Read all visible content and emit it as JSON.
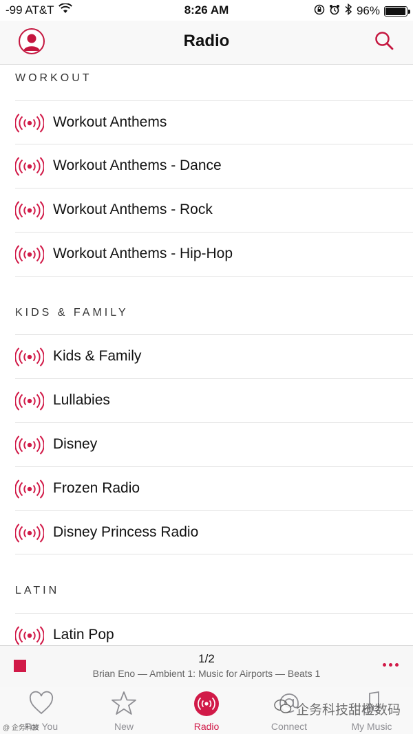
{
  "status_bar": {
    "carrier": "-99 AT&T",
    "time": "8:26 AM",
    "battery_percent": "96%",
    "battery_level": 0.96,
    "icons": [
      "wifi-icon",
      "orientation-lock-icon",
      "alarm-icon",
      "bluetooth-icon",
      "battery-icon"
    ]
  },
  "nav": {
    "title": "Radio",
    "left_icon": "profile-icon",
    "right_icon": "search-icon"
  },
  "sections": [
    {
      "header": "WORKOUT",
      "items": [
        "Workout Anthems",
        "Workout Anthems - Dance",
        "Workout Anthems - Rock",
        "Workout Anthems - Hip-Hop"
      ]
    },
    {
      "header": "KIDS & FAMILY",
      "items": [
        "Kids & Family",
        "Lullabies",
        "Disney",
        "Frozen Radio",
        "Disney Princess Radio"
      ]
    },
    {
      "header": "LATIN",
      "items": [
        "Latin Pop"
      ]
    }
  ],
  "mini_player": {
    "title": "1/2",
    "subtitle": "Brian Eno — Ambient 1: Music for Airports — Beats 1",
    "stop_icon": "stop-icon",
    "more_icon": "more-icon"
  },
  "tab_bar": {
    "tabs": [
      {
        "label": "For You",
        "icon": "heart-icon",
        "active": false
      },
      {
        "label": "New",
        "icon": "star-icon",
        "active": false
      },
      {
        "label": "Radio",
        "icon": "radio-icon",
        "active": true
      },
      {
        "label": "Connect",
        "icon": "at-icon",
        "active": false
      },
      {
        "label": "My Music",
        "icon": "music-note-icon",
        "active": false
      }
    ]
  },
  "watermark": {
    "text": "企务科技甜橙数码",
    "left_text": "@ 企务科技"
  },
  "colors": {
    "accent": "#d11a48",
    "bar_background": "#f8f8f8",
    "separator": "#e2e2e2"
  }
}
